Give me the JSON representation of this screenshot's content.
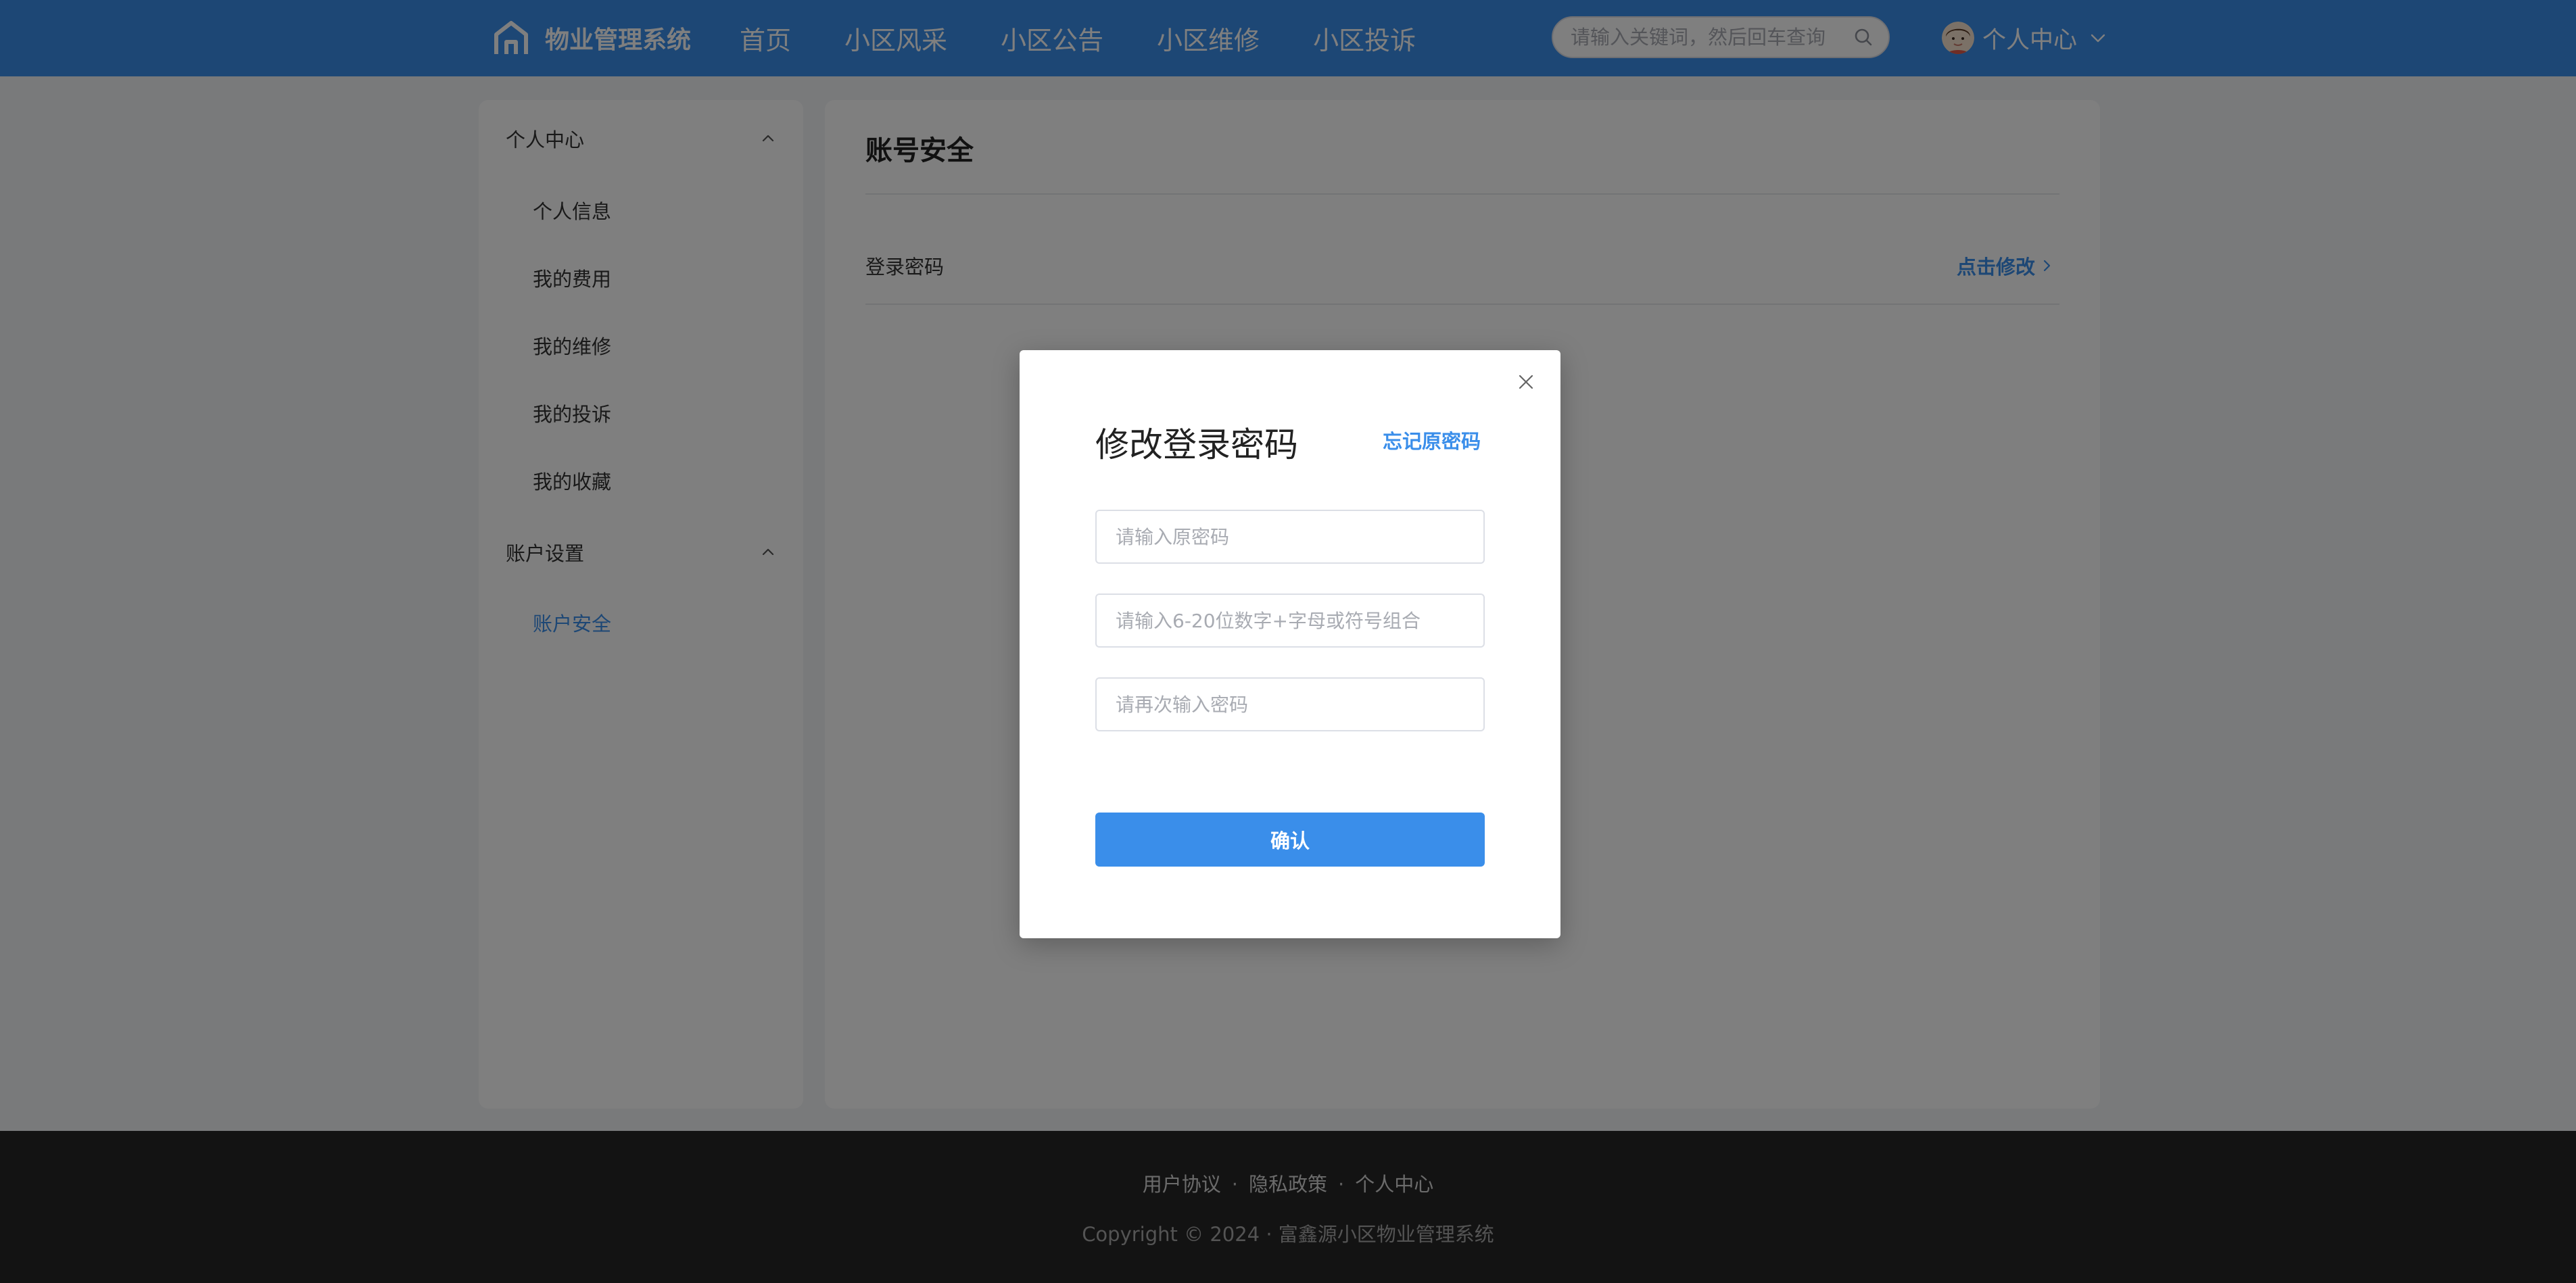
{
  "header": {
    "brand": "物业管理系统",
    "nav": [
      "首页",
      "小区风采",
      "小区公告",
      "小区维修",
      "小区投诉"
    ],
    "search_placeholder": "请输入关键词，然后回车查询",
    "user_label": "个人中心",
    "color": "#3a8eea"
  },
  "sidebar": {
    "groups": [
      {
        "title": "个人中心",
        "items": [
          "个人信息",
          "我的费用",
          "我的维修",
          "我的投诉",
          "我的收藏"
        ]
      },
      {
        "title": "账户设置",
        "items": [
          "账户安全"
        ]
      }
    ],
    "active_item": "账户安全"
  },
  "main": {
    "title": "账号安全",
    "row_label": "登录密码",
    "edit_label": "点击修改"
  },
  "dialog": {
    "title": "修改登录密码",
    "forgot_label": "忘记原密码",
    "old_placeholder": "请输入原密码",
    "new_placeholder": "请输入6-20位数字+字母或符号组合",
    "repeat_placeholder": "请再次输入密码",
    "confirm_label": "确认"
  },
  "footer": {
    "links": [
      "用户协议",
      "隐私政策",
      "个人中心"
    ],
    "separator": "·",
    "copyright": "Copyright © 2024 · 富鑫源小区物业管理系统"
  },
  "icons": {
    "logo": "house-icon",
    "search": "search-icon",
    "user_chevron": "chevron-down-icon",
    "group_chevron": "chevron-up-icon",
    "edit_chevron": "chevron-right-icon",
    "close": "close-icon"
  }
}
